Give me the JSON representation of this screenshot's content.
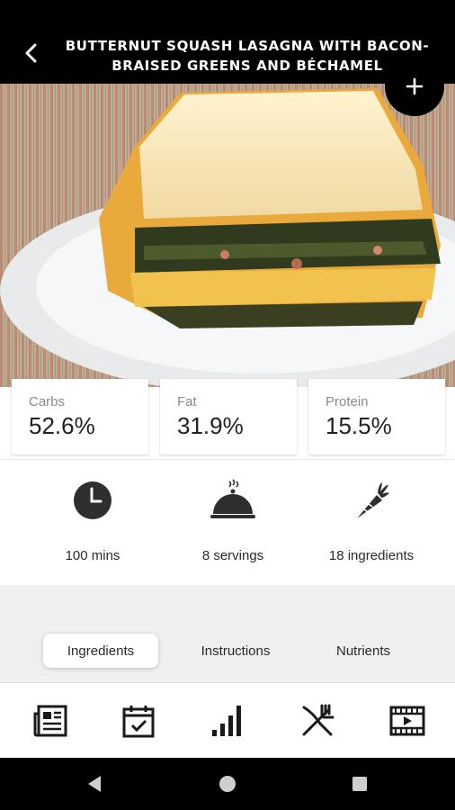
{
  "header": {
    "title": "BUTTERNUT SQUASH LASAGNA WITH BACON-BRAISED GREENS AND BÉCHAMEL",
    "back_icon": "chevron-left-icon",
    "add_icon": "plus-icon"
  },
  "hero": {
    "image": "lasagna-photo"
  },
  "macros": [
    {
      "label": "Carbs",
      "value": "52.6%"
    },
    {
      "label": "Fat",
      "value": "31.9%"
    },
    {
      "label": "Protein",
      "value": "15.5%"
    }
  ],
  "stats": [
    {
      "icon": "clock-icon",
      "label": "100 mins"
    },
    {
      "icon": "serving-cloche-icon",
      "label": "8 servings"
    },
    {
      "icon": "carrot-icon",
      "label": "18 ingredients"
    }
  ],
  "tabs": [
    {
      "label": "Ingredients",
      "active": true
    },
    {
      "label": "Instructions",
      "active": false
    },
    {
      "label": "Nutrients",
      "active": false
    }
  ],
  "bottom_nav": [
    {
      "icon": "newspaper-icon"
    },
    {
      "icon": "calendar-check-icon"
    },
    {
      "icon": "bar-chart-icon"
    },
    {
      "icon": "fork-knife-icon"
    },
    {
      "icon": "video-icon"
    }
  ],
  "system_nav": [
    {
      "icon": "back-triangle-icon"
    },
    {
      "icon": "home-circle-icon"
    },
    {
      "icon": "recents-square-icon"
    }
  ]
}
